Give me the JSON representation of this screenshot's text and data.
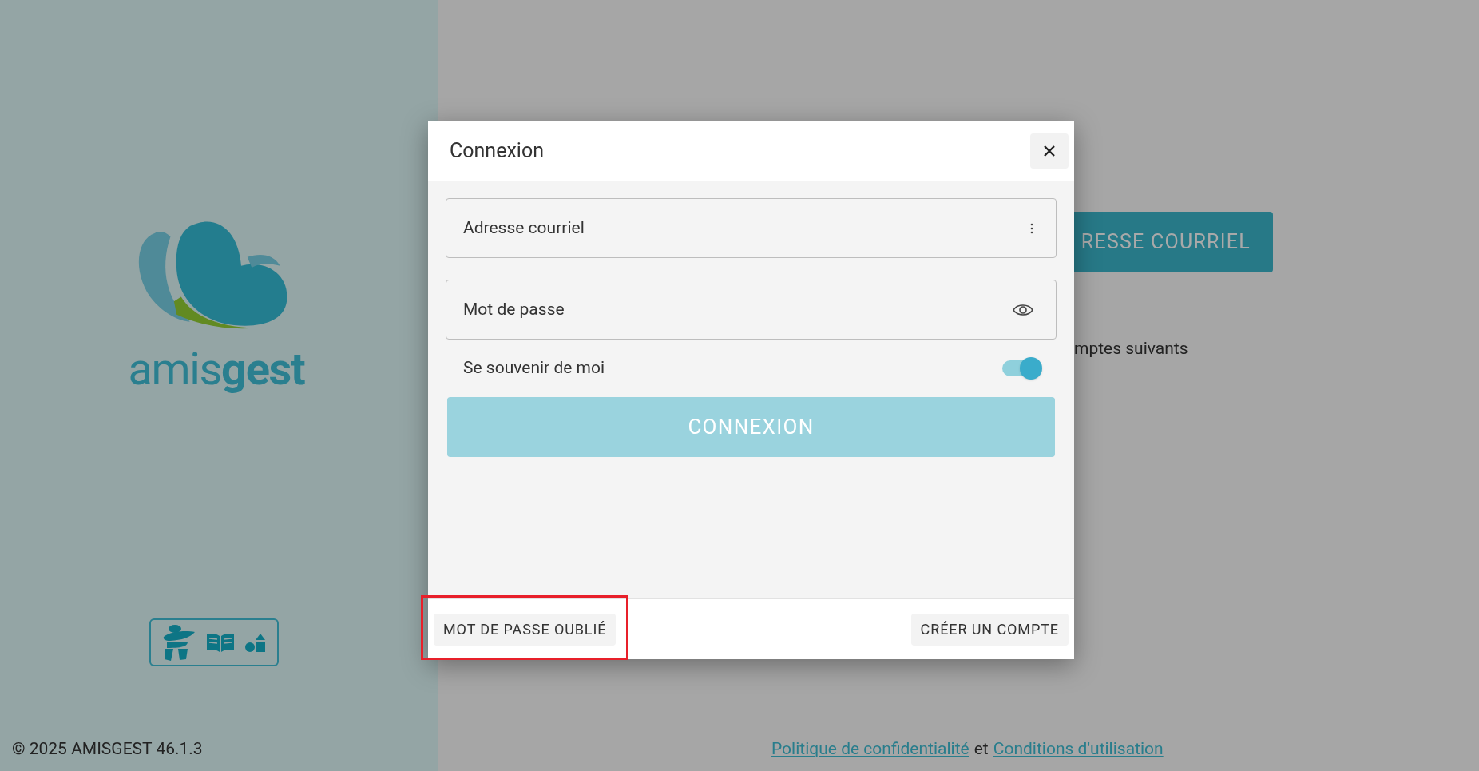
{
  "brand": {
    "wordmark": "amis**gest**"
  },
  "copyright": "© 2025 AMISGEST 46.1.3",
  "background": {
    "button": "RESSE COURRIEL",
    "text": "mptes suivants"
  },
  "legal": {
    "links": [
      "Politique de confidentialité",
      "Conditions d'utilisation"
    ],
    "joiner": "et"
  },
  "dialog": {
    "title": "Connexion",
    "fields": [
      {
        "kind": "menu",
        "placeholder": "Adresse courriel"
      },
      {
        "kind": "password",
        "placeholder": "Mot de passe"
      }
    ],
    "remember": {
      "label": "Se souvenir de moi",
      "on": true
    },
    "submit": {
      "label": "CONNEXION",
      "disabled": true
    },
    "footer": [
      {
        "label": "MOT DE PASSE OUBLIÉ",
        "highlighted": true
      },
      {
        "label": "CRÉER UN COMPTE",
        "highlighted": false
      }
    ]
  }
}
